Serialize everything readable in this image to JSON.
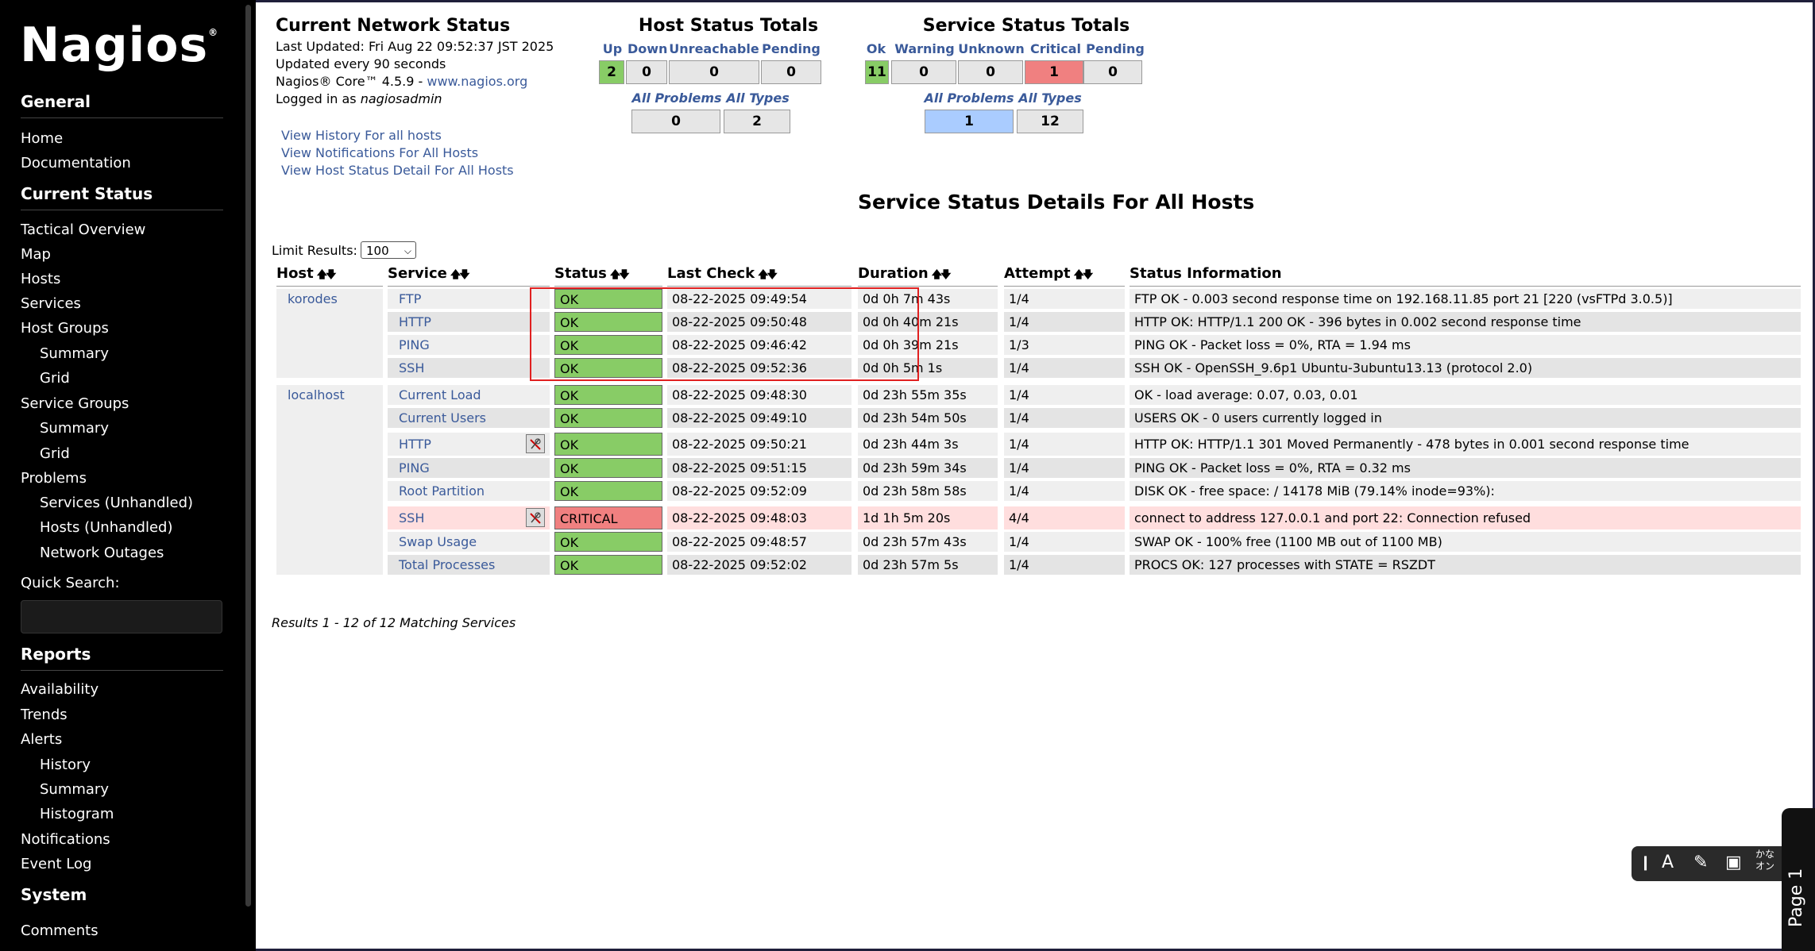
{
  "sidebar": {
    "logo": "Nagios",
    "logo_mark": "®",
    "sections": {
      "general": "General",
      "current_status": "Current Status",
      "reports": "Reports",
      "system": "System"
    },
    "general_items": [
      "Home",
      "Documentation"
    ],
    "status_items": [
      "Tactical Overview",
      "Map",
      "Hosts",
      "Services",
      "Host Groups",
      "Summary",
      "Grid",
      "Service Groups",
      "Summary",
      "Grid",
      "Problems",
      "Services (Unhandled)",
      "Hosts (Unhandled)",
      "Network Outages"
    ],
    "quick_search_label": "Quick Search:",
    "report_items": [
      "Availability",
      "Trends",
      "Alerts",
      "History",
      "Summary",
      "Histogram",
      "Notifications",
      "Event Log"
    ],
    "system_items": [
      "Comments"
    ]
  },
  "info": {
    "title": "Current Network Status",
    "last_updated": "Last Updated: Fri Aug 22 09:52:37 JST 2025",
    "update_interval": "Updated every 90 seconds",
    "version_prefix": "Nagios® Core™ 4.5.9 - ",
    "version_link": "www.nagios.org",
    "logged_in_prefix": "Logged in as ",
    "user": "nagiosadmin",
    "links": [
      "View History For all hosts",
      "View Notifications For All Hosts",
      "View Host Status Detail For All Hosts"
    ]
  },
  "host_totals": {
    "title": "Host Status Totals",
    "headers": [
      "Up",
      "Down",
      "Unreachable",
      "Pending"
    ],
    "values": [
      "2",
      "0",
      "0",
      "0"
    ],
    "sub_headers": [
      "All Problems",
      "All Types"
    ],
    "sub_values": [
      "0",
      "2"
    ]
  },
  "service_totals": {
    "title": "Service Status Totals",
    "headers": [
      "Ok",
      "Warning",
      "Unknown",
      "Critical",
      "Pending"
    ],
    "values": [
      "11",
      "0",
      "0",
      "1",
      "0"
    ],
    "sub_headers": [
      "All Problems",
      "All Types"
    ],
    "sub_values": [
      "1",
      "12"
    ]
  },
  "page_title": "Service Status Details For All Hosts",
  "limit": {
    "label": "Limit Results:",
    "value": "100"
  },
  "table": {
    "headers": [
      "Host",
      "Service",
      "Status",
      "Last Check",
      "Duration",
      "Attempt",
      "Status Information"
    ],
    "rows": [
      {
        "host": "korodes",
        "service": "FTP",
        "status": "OK",
        "last_check": "08-22-2025 09:49:54",
        "duration": "0d 0h 7m 43s",
        "attempt": "1/4",
        "info": "FTP OK - 0.003 second response time on 192.168.11.85 port 21 [220 (vsFTPd 3.0.5)]"
      },
      {
        "host": "",
        "service": "HTTP",
        "status": "OK",
        "last_check": "08-22-2025 09:50:48",
        "duration": "0d 0h 40m 21s",
        "attempt": "1/4",
        "info": "HTTP OK: HTTP/1.1 200 OK - 396 bytes in 0.002 second response time"
      },
      {
        "host": "",
        "service": "PING",
        "status": "OK",
        "last_check": "08-22-2025 09:46:42",
        "duration": "0d 0h 39m 21s",
        "attempt": "1/3",
        "info": "PING OK - Packet loss = 0%, RTA = 1.94 ms"
      },
      {
        "host": "",
        "service": "SSH",
        "status": "OK",
        "last_check": "08-22-2025 09:52:36",
        "duration": "0d 0h 5m 1s",
        "attempt": "1/4",
        "info": "SSH OK - OpenSSH_9.6p1 Ubuntu-3ubuntu13.13 (protocol 2.0)"
      },
      {
        "host": "localhost",
        "service": "Current Load",
        "status": "OK",
        "last_check": "08-22-2025 09:48:30",
        "duration": "0d 23h 55m 35s",
        "attempt": "1/4",
        "info": "OK - load average: 0.07, 0.03, 0.01"
      },
      {
        "host": "",
        "service": "Current Users",
        "status": "OK",
        "last_check": "08-22-2025 09:49:10",
        "duration": "0d 23h 54m 50s",
        "attempt": "1/4",
        "info": "USERS OK - 0 users currently logged in"
      },
      {
        "host": "",
        "service": "HTTP",
        "status": "OK",
        "last_check": "08-22-2025 09:50:21",
        "duration": "0d 23h 44m 3s",
        "attempt": "1/4",
        "info": "HTTP OK: HTTP/1.1 301 Moved Permanently - 478 bytes in 0.001 second response time"
      },
      {
        "host": "",
        "service": "PING",
        "status": "OK",
        "last_check": "08-22-2025 09:51:15",
        "duration": "0d 23h 59m 34s",
        "attempt": "1/4",
        "info": "PING OK - Packet loss = 0%, RTA = 0.32 ms"
      },
      {
        "host": "",
        "service": "Root Partition",
        "status": "OK",
        "last_check": "08-22-2025 09:52:09",
        "duration": "0d 23h 58m 58s",
        "attempt": "1/4",
        "info": "DISK OK - free space: / 14178 MiB (79.14% inode=93%):"
      },
      {
        "host": "",
        "service": "SSH",
        "status": "CRITICAL",
        "last_check": "08-22-2025 09:48:03",
        "duration": "1d 1h 5m 20s",
        "attempt": "4/4",
        "info": "connect to address 127.0.0.1 and port 22: Connection refused"
      },
      {
        "host": "",
        "service": "Swap Usage",
        "status": "OK",
        "last_check": "08-22-2025 09:48:57",
        "duration": "0d 23h 57m 43s",
        "attempt": "1/4",
        "info": "SWAP OK - 100% free (1100 MB out of 1100 MB)"
      },
      {
        "host": "",
        "service": "Total Processes",
        "status": "OK",
        "last_check": "08-22-2025 09:52:02",
        "duration": "0d 23h 57m 5s",
        "attempt": "1/4",
        "info": "PROCS OK: 127 processes with STATE = RSZDT"
      }
    ]
  },
  "results_text": "Results 1 - 12 of 12 Matching Services",
  "ime": {
    "kana": "かな",
    "kana2": "オン",
    "font_glyph": "A"
  },
  "page_tab": "Page 1",
  "colors": {
    "ok": "#88cc66",
    "critical": "#f08080",
    "link": "#3a5a9a",
    "highlight": "#e02020"
  }
}
